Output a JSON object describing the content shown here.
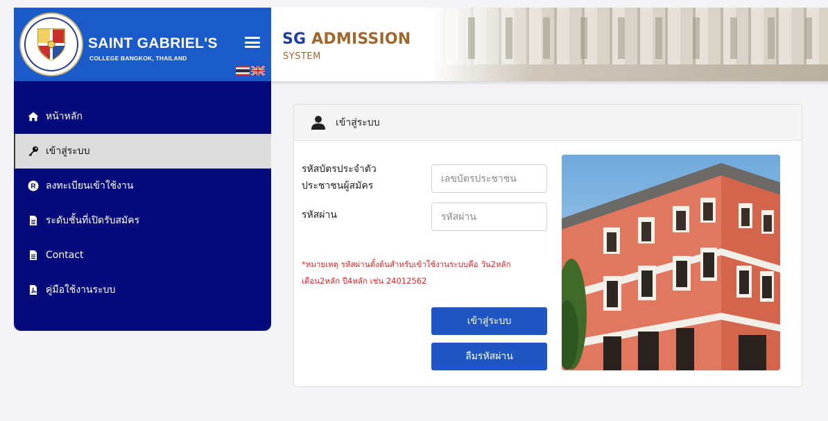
{
  "brand": {
    "title": "SAINT GABRIEL'S",
    "subtitle": "COLLEGE BANGKOK, THAILAND"
  },
  "header": {
    "app_name_part1": "SG",
    "app_name_part2": "ADMISSION",
    "app_system": "SYSTEM"
  },
  "sidebar": {
    "items": [
      {
        "label": "หน้าหลัก",
        "icon": "home-icon",
        "active": false
      },
      {
        "label": "เข้าสู่ระบบ",
        "icon": "key-icon",
        "active": true
      },
      {
        "label": "ลงทะเบียนเข้าใช้งาน",
        "icon": "registered-icon",
        "active": false
      },
      {
        "label": "ระดับชั้นที่เปิดรับสมัคร",
        "icon": "file-icon",
        "active": false
      },
      {
        "label": "Contact",
        "icon": "file-icon",
        "active": false
      },
      {
        "label": "คู่มือใช้งานระบบ",
        "icon": "pdf-icon",
        "active": false
      }
    ]
  },
  "login": {
    "title": "เข้าสู่ระบบ",
    "id_label_line1": "รหัสบัตรประจำตัว",
    "id_label_line2": "ประชาชนผู้สมัคร",
    "id_placeholder": "เลขบัตรประชาชน",
    "password_label": "รหัสผ่าน",
    "password_placeholder": "รหัสผ่าน",
    "note_line1": "*หมายเหตุ รหัสผ่านตั้งต้นสำหรับเข้าใช้งานระบบคือ วัน2หลัก",
    "note_line2": "เดือน2หลัก ปี4หลัก เช่น 24012562",
    "login_button": "เข้าสู่ระบบ",
    "forgot_button": "ลืมรหัสผ่าน"
  },
  "colors": {
    "sidebar_bg": "#060b7c",
    "brand_bg": "#1b5bc9",
    "button_bg": "#1f56c3",
    "note_text": "#d7262a",
    "accent_brown": "#a0662b"
  }
}
